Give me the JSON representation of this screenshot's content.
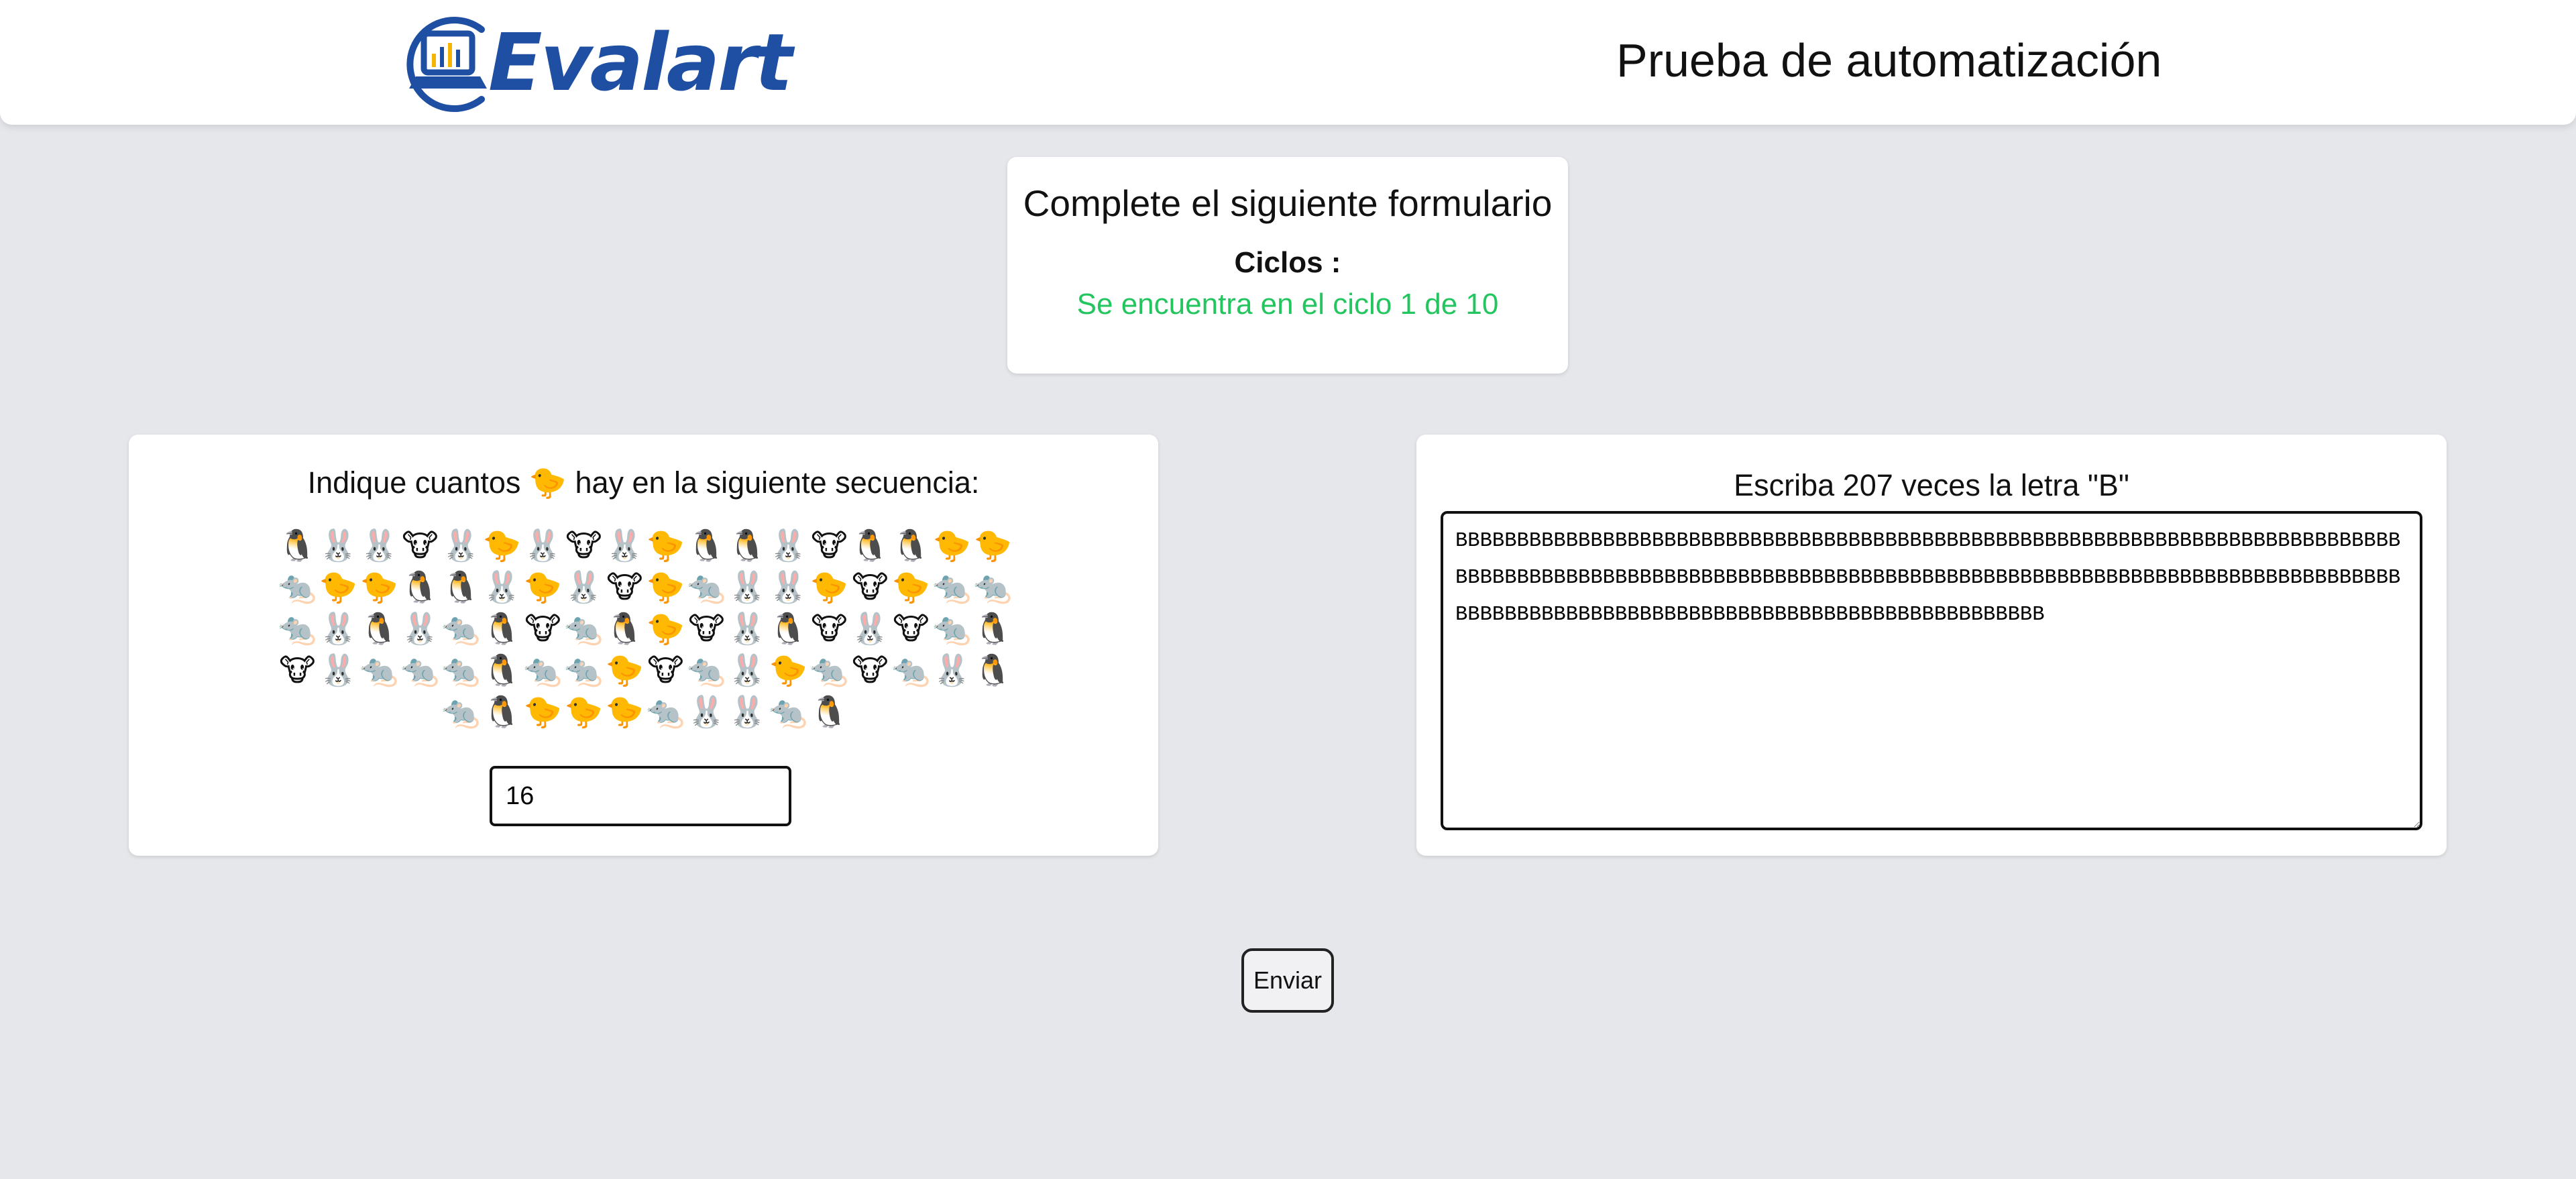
{
  "header": {
    "logo_text": "Evalart",
    "title": "Prueba de automatización"
  },
  "form": {
    "title": "Complete el siguiente formulario",
    "cycles_label": "Ciclos :",
    "cycles_status": "Se encuentra en el ciclo 1 de 10"
  },
  "question": {
    "prefix": "Indique cuantos",
    "target_emoji": "🐤",
    "suffix": "hay en la siguiente secuencia:",
    "sequence_rows": [
      [
        "🐧",
        "🐰",
        "🐰",
        "🐮",
        "🐰",
        "🐤",
        "🐰",
        "🐮",
        "🐰",
        "🐤",
        "🐧",
        "🐧",
        "🐰",
        "🐮",
        "🐧",
        "🐧",
        "🐤",
        "🐤"
      ],
      [
        "🐀",
        "🐤",
        "🐤",
        "🐧",
        "🐧",
        "🐰",
        "🐤",
        "🐰",
        "🐮",
        "🐤",
        "🐀",
        "🐰",
        "🐰",
        "🐤",
        "🐮",
        "🐤",
        "🐀",
        "🐀"
      ],
      [
        "🐀",
        "🐰",
        "🐧",
        "🐰",
        "🐀",
        "🐧",
        "🐮",
        "🐀",
        "🐧",
        "🐤",
        "🐮",
        "🐰",
        "🐧",
        "🐮",
        "🐰",
        "🐮",
        "🐀",
        "🐧"
      ],
      [
        "🐮",
        "🐰",
        "🐀",
        "🐀",
        "🐀",
        "🐧",
        "🐀",
        "🐀",
        "🐤",
        "🐮",
        "🐀",
        "🐰",
        "🐤",
        "🐀",
        "🐮",
        "🐀",
        "🐰",
        "🐧"
      ],
      [
        "🐀",
        "🐧",
        "🐤",
        "🐤",
        "🐤",
        "🐀",
        "🐰",
        "🐰",
        "🐀",
        "🐧"
      ]
    ],
    "answer_value": "16"
  },
  "writing": {
    "label": "Escriba 207 veces la letra \"B\"",
    "text_value": "BBBBBBBBBBBBBBBBBBBBBBBBBBBBBBBBBBBBBBBBBBBBBBBBBBBBBBBBBBBBBBBBBBBBBBBBBBBBBBBBBBBBBBBBBBBBBBBBBBBBBBBBBBBBBBBBBBBBBBBBBBBBBBBBBBBBBBBBBBBBBBBBBBBBBBBBBBBBBBBBBBBBBBBBBBBBBBBBBBBBBBBBBBBBBBBBBBBBBBBBBB"
  },
  "submit_label": "Enviar",
  "colors": {
    "background": "#e5e7eb",
    "status_green": "#22c55e",
    "logo_blue": "#1e4fa3"
  }
}
